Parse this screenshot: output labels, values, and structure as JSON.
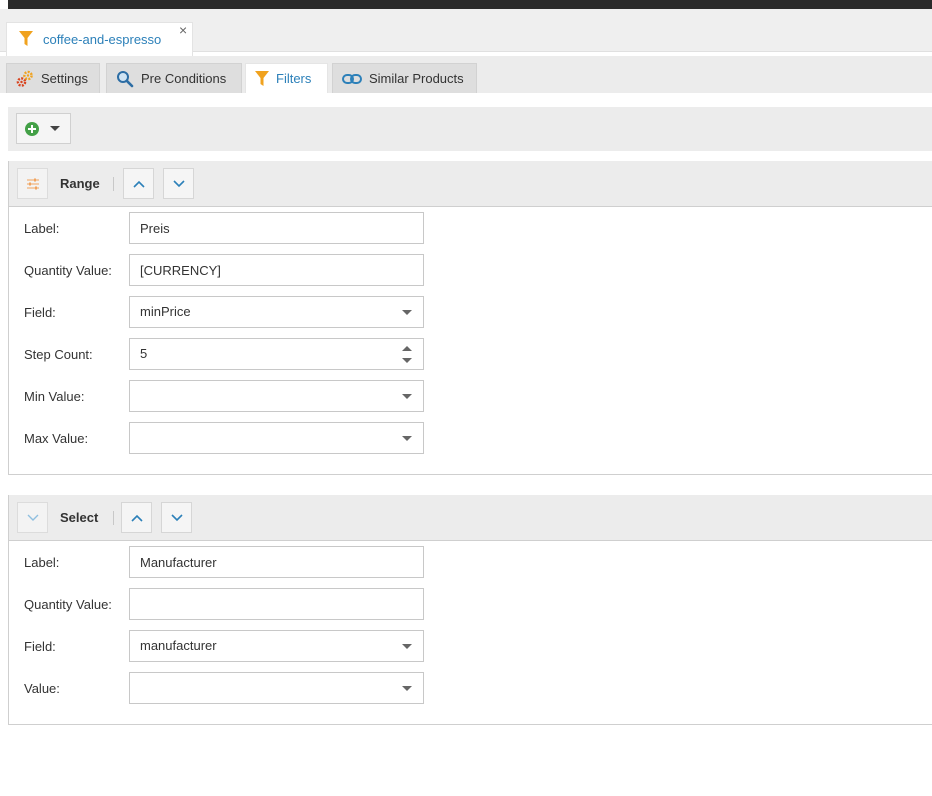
{
  "document_tab": {
    "title": "coffee-and-espresso",
    "close_glyph": "×",
    "icon": "funnel-icon"
  },
  "subtabs": [
    {
      "label": "Settings",
      "icon": "gears-icon"
    },
    {
      "label": "Pre Conditions",
      "icon": "search-icon"
    },
    {
      "label": "Filters",
      "icon": "funnel-icon",
      "active": true
    },
    {
      "label": "Similar Products",
      "icon": "link-icon"
    }
  ],
  "toolbar": {
    "add_button_icon": "add-icon"
  },
  "colors": {
    "accent": "#2c80b9",
    "funnel": "#f0a21e",
    "add_green": "#43a047",
    "panel_header": "#ececec"
  },
  "panels": [
    {
      "title": "Range",
      "header_icon": "sliders-icon",
      "fields": [
        {
          "label": "Label:",
          "value": "Preis",
          "type": "text"
        },
        {
          "label": "Quantity Value:",
          "value": "[CURRENCY]",
          "type": "text"
        },
        {
          "label": "Field:",
          "value": "minPrice",
          "type": "select"
        },
        {
          "label": "Step Count:",
          "value": "5",
          "type": "number"
        },
        {
          "label": "Min Value:",
          "value": "",
          "type": "select"
        },
        {
          "label": "Max Value:",
          "value": "",
          "type": "select"
        }
      ]
    },
    {
      "title": "Select",
      "header_icon": "chevron-down-icon",
      "fields": [
        {
          "label": "Label:",
          "value": "Manufacturer",
          "type": "text"
        },
        {
          "label": "Quantity Value:",
          "value": "",
          "type": "text"
        },
        {
          "label": "Field:",
          "value": "manufacturer",
          "type": "select"
        },
        {
          "label": "Value:",
          "value": "",
          "type": "select"
        }
      ]
    }
  ]
}
